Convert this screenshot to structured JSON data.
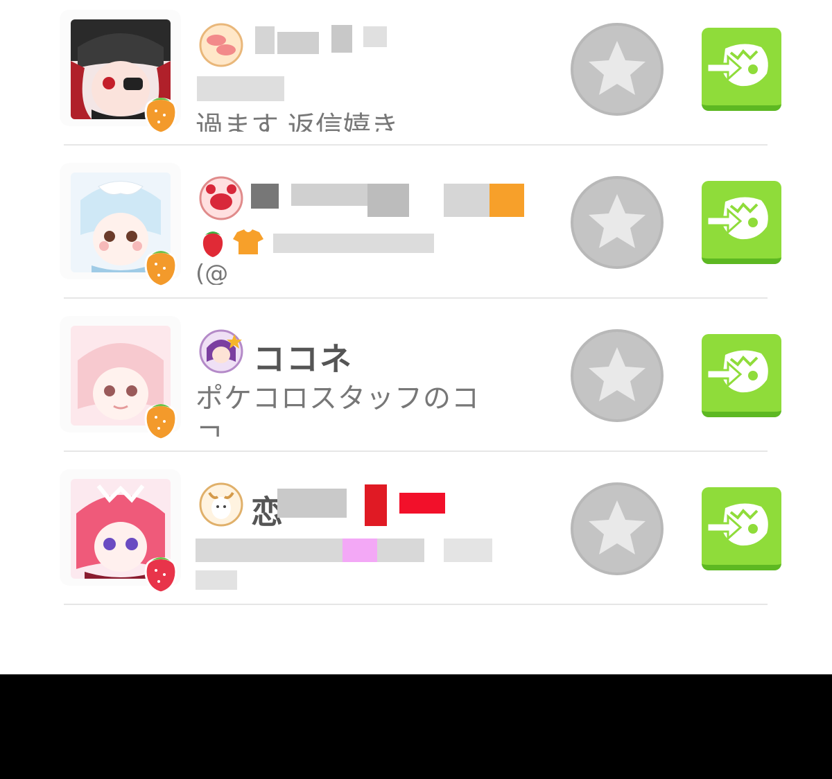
{
  "rows": [
    {
      "zodiac_icon": "pisces-icon",
      "name": "",
      "desc_line1": "",
      "desc_line2": "",
      "desc_fragment": "過ます 返信嬉き"
    },
    {
      "zodiac_icon": "cancer-icon",
      "name": "",
      "desc_line1": "",
      "desc_line2": "",
      "desc_fragment": "(@"
    },
    {
      "zodiac_icon": "virgo-icon",
      "name": "ココネ",
      "desc_line1": "ポケコロスタッフのコ",
      "desc_line2": "コ..."
    },
    {
      "zodiac_icon": "capricorn-icon",
      "name": "",
      "desc_line1": "",
      "desc_line2": "",
      "desc_fragment": "恋"
    }
  ],
  "colors": {
    "accent_green": "#8fdc3a",
    "favorite_gray": "#c4c4c4",
    "text": "#555555"
  }
}
